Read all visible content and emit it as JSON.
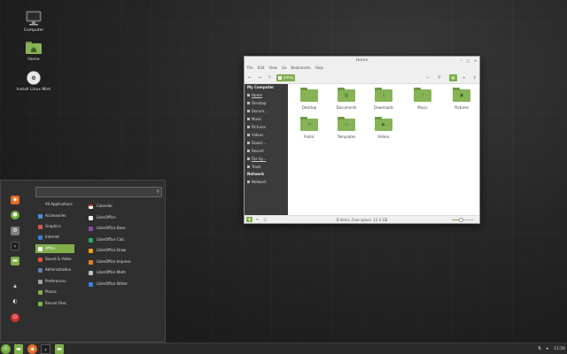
{
  "desktop": {
    "icons": [
      {
        "label": "Computer",
        "icon": "monitor-icon"
      },
      {
        "label": "Home",
        "icon": "home-folder-icon"
      },
      {
        "label": "Install Linux Mint",
        "icon": "disc-icon"
      }
    ]
  },
  "file_manager": {
    "title": "Home",
    "menu": [
      "File",
      "Edit",
      "View",
      "Go",
      "Bookmarks",
      "Help"
    ],
    "breadcrumb": "jetma",
    "sidebar": {
      "my_computer": "My Computer",
      "items": [
        "Home",
        "Desktop",
        "Docum...",
        "Music",
        "Pictures",
        "Videos",
        "Downl...",
        "Recent",
        "File Sy...",
        "Trash"
      ],
      "network": "Network",
      "network_items": [
        "Network"
      ]
    },
    "files": [
      "Desktop",
      "Documents",
      "Downloads",
      "Music",
      "Pictures",
      "Public",
      "Templates",
      "Videos"
    ],
    "status": "8 items, Free space: 12.4 GB",
    "zoom_level": 0.4
  },
  "start_menu": {
    "search_placeholder": "",
    "categories": [
      "All Applications",
      "Accessories",
      "Graphics",
      "Internet",
      "Office",
      "Sound & Video",
      "Administration",
      "Preferences",
      "Places",
      "Recent Files"
    ],
    "active_category": "Office",
    "apps": [
      "Calendar",
      "LibreOffice",
      "LibreOffice Base",
      "LibreOffice Calc",
      "LibreOffice Draw",
      "LibreOffice Impress",
      "LibreOffice Math",
      "LibreOffice Writer"
    ]
  },
  "taskbar": {
    "clock": "11:56"
  },
  "colors": {
    "accent": "#7fae4b",
    "sidebar": "#3b3b3b",
    "menu_bg": "#2f2f2f",
    "taskbar": "#2b2b2b"
  }
}
